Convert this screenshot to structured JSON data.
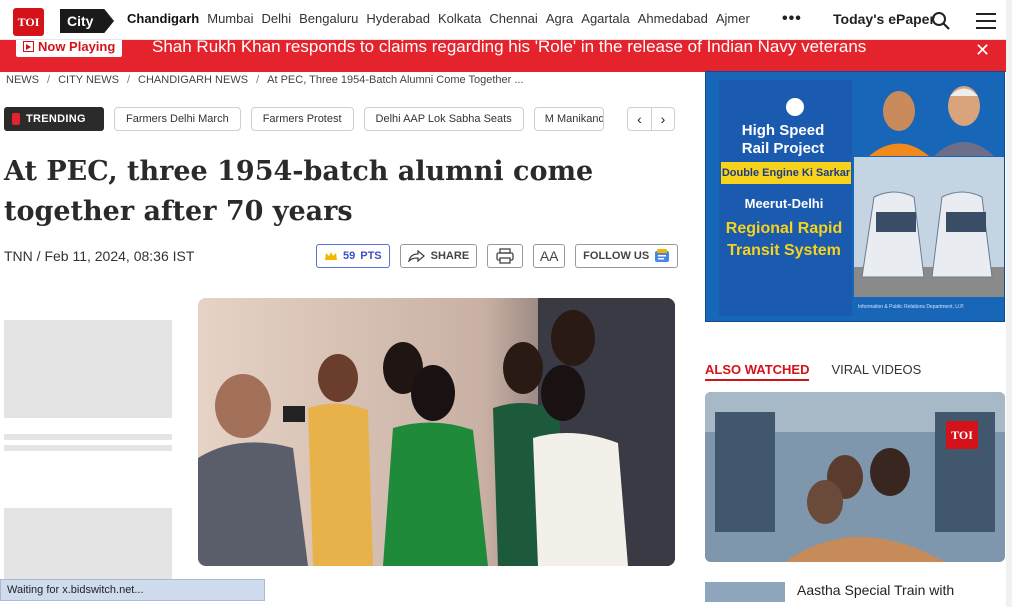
{
  "topnav": {
    "logo": "TOI",
    "city_label": "City",
    "cities": [
      "Chandigarh",
      "Mumbai",
      "Delhi",
      "Bengaluru",
      "Hyderabad",
      "Kolkata",
      "Chennai",
      "Agra",
      "Agartala",
      "Ahmedabad",
      "Ajmer"
    ],
    "more": "•••",
    "epaper": "Today's ePaper"
  },
  "now_playing": {
    "label": "Now Playing",
    "title": "Shah Rukh Khan responds to claims regarding his 'Role' in the release of Indian Navy veterans",
    "close": "✕"
  },
  "breadcrumb": [
    "NEWS",
    "CITY NEWS",
    "CHANDIGARH NEWS",
    "At PEC, Three 1954-Batch Alumni Come Together ..."
  ],
  "trending": {
    "label": "TRENDING",
    "chips": [
      "Farmers Delhi March",
      "Farmers Protest",
      "Delhi AAP Lok Sabha Seats",
      "M Manikandan"
    ]
  },
  "article": {
    "headline": "At PEC, three 1954-batch alumni come together after 70 years",
    "byline": "TNN / Feb 11, 2024, 08:36 IST",
    "points_label": "PTS",
    "points_value": "59",
    "share_label": "SHARE",
    "font_label": "AA",
    "follow_label": "FOLLOW US"
  },
  "status_bar": "Waiting for x.bidswitch.net...",
  "ad": {
    "line1": "High Speed Rail Project",
    "line2": "Double Engine Ki Sarkar",
    "line3": "Meerut-Delhi",
    "line4": "Regional Rapid Transit System",
    "footer": "Information & Public Relations Department, U.P."
  },
  "sidebar": {
    "tab_active": "ALSO WATCHED",
    "tab_other": "VIRAL VIDEOS",
    "video_badge": "TOI",
    "related_title": "Aastha Special Train with"
  },
  "colors": {
    "brand_red": "#d3121a",
    "now_bar": "#e4232c",
    "ad_blue": "#1766b8",
    "ad_yellow": "#f8d31b"
  }
}
